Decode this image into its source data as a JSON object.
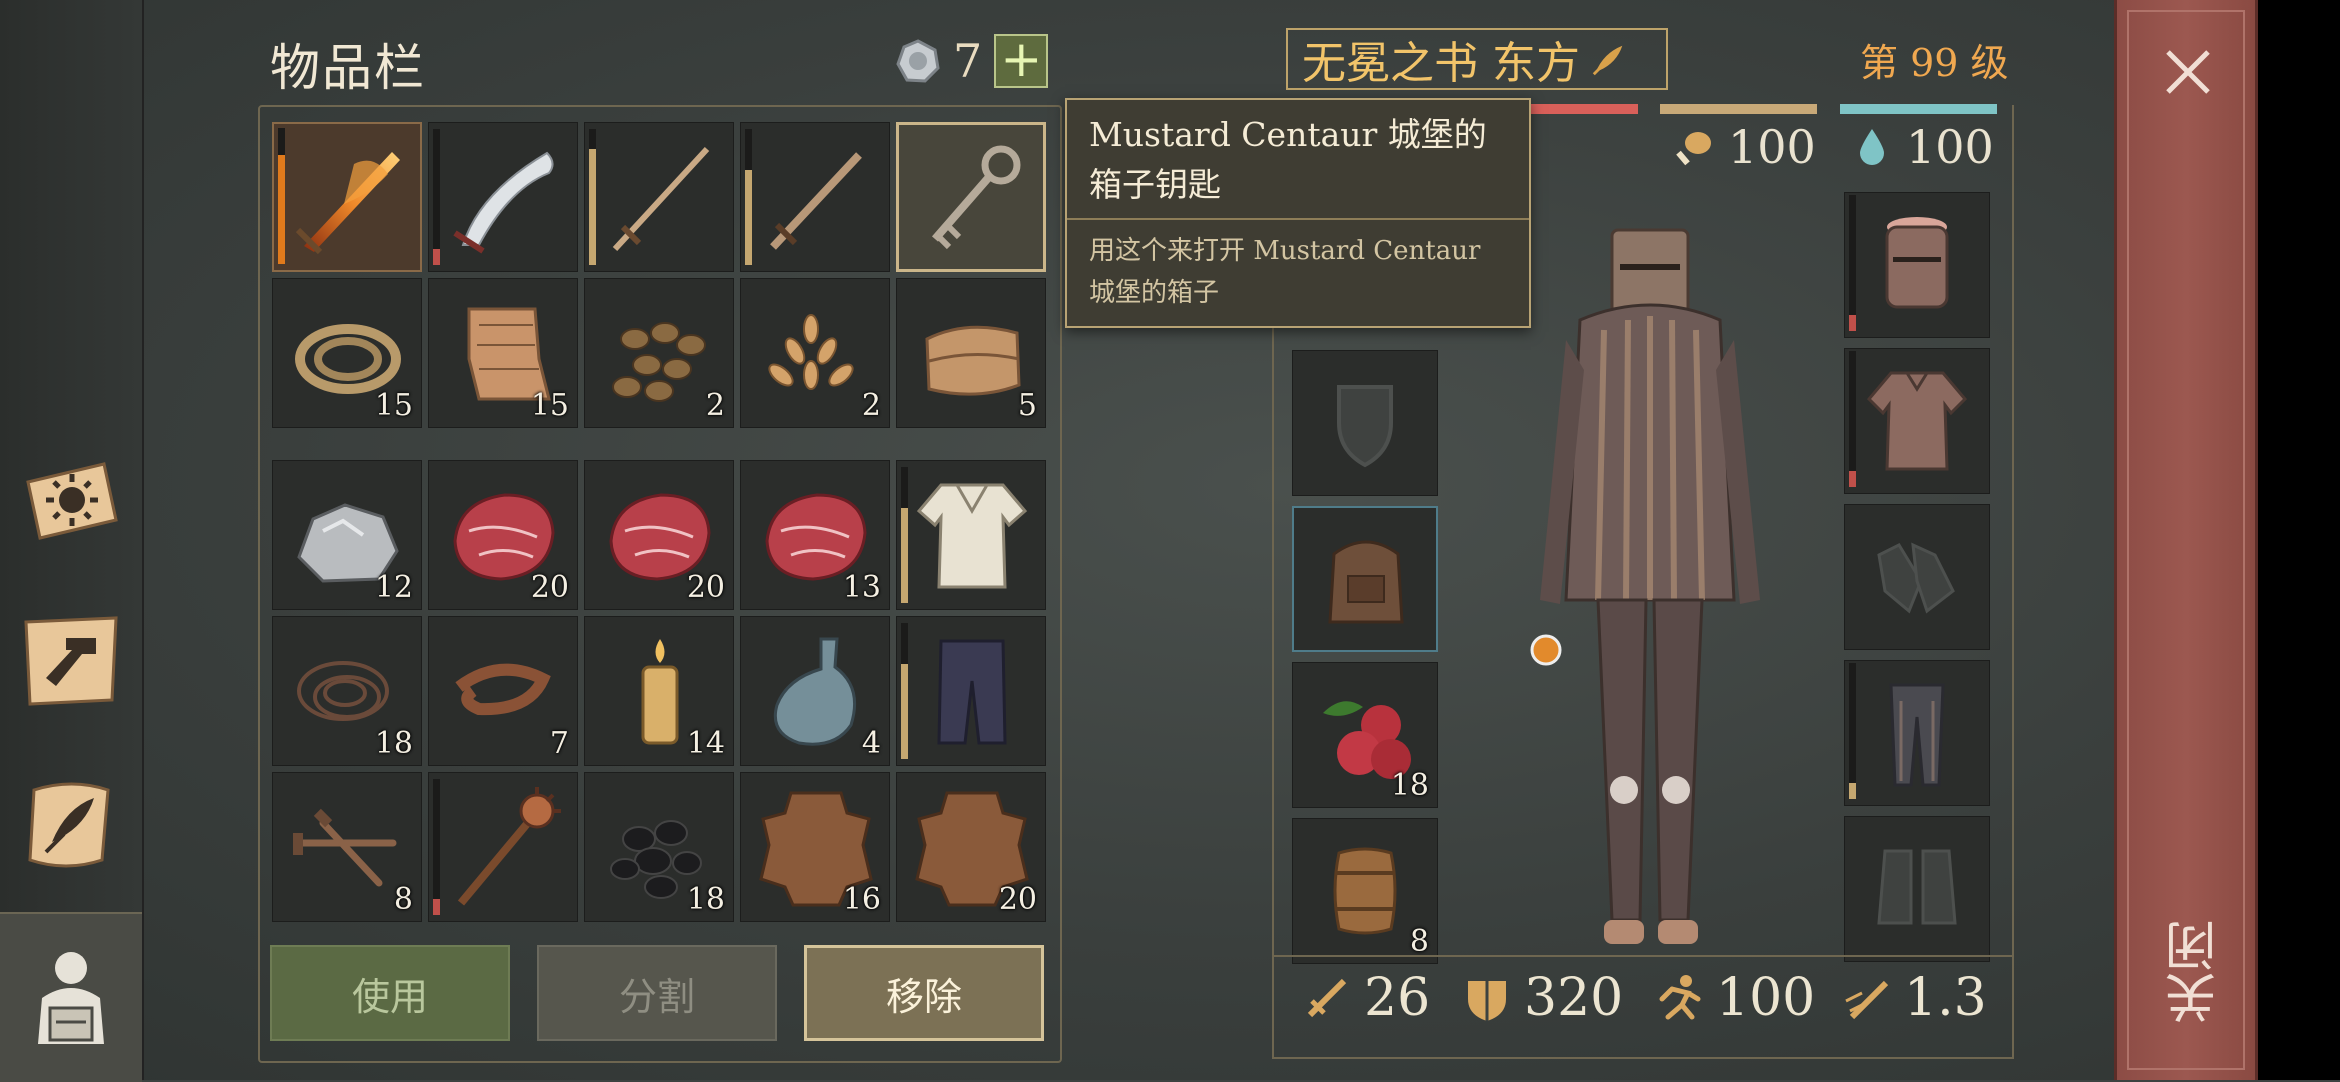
{
  "inventory": {
    "title": "物品栏",
    "currency": {
      "icon": "silver-coin-icon",
      "count": "7",
      "add_label": "+"
    },
    "items": [
      {
        "name": "flaming-sword",
        "qty": "",
        "durability": 0.8,
        "dur_color": "#e07a1c",
        "selected": false,
        "highlight": true
      },
      {
        "name": "scimitar",
        "qty": "",
        "durability": 0.12,
        "dur_color": "#c0504a"
      },
      {
        "name": "longsword",
        "qty": "",
        "durability": 0.85,
        "dur_color": "#c5a770"
      },
      {
        "name": "sword",
        "qty": "",
        "durability": 0.7,
        "dur_color": "#c5a770"
      },
      {
        "name": "key",
        "qty": "",
        "selected": true
      },
      {
        "name": "rope",
        "qty": "15"
      },
      {
        "name": "cloth",
        "qty": "15"
      },
      {
        "name": "beans",
        "qty": "2"
      },
      {
        "name": "seeds",
        "qty": "2"
      },
      {
        "name": "leather-folded",
        "qty": "5"
      },
      {
        "name": "ore-rock",
        "qty": "12"
      },
      {
        "name": "raw-meat",
        "qty": "20"
      },
      {
        "name": "raw-meat",
        "qty": "20"
      },
      {
        "name": "raw-meat",
        "qty": "13"
      },
      {
        "name": "shirt",
        "qty": "",
        "durability": 0.7,
        "dur_color": "#c5a770"
      },
      {
        "name": "string-coil",
        "qty": "18"
      },
      {
        "name": "leather-strap",
        "qty": "7"
      },
      {
        "name": "candle",
        "qty": "14"
      },
      {
        "name": "glass-bottle",
        "qty": "4"
      },
      {
        "name": "trousers",
        "qty": "",
        "durability": 0.7,
        "dur_color": "#c5a770"
      },
      {
        "name": "nails",
        "qty": "8"
      },
      {
        "name": "spiked-mace",
        "qty": "",
        "durability": 0.12,
        "dur_color": "#c0504a"
      },
      {
        "name": "coal",
        "qty": "18"
      },
      {
        "name": "hide",
        "qty": "16"
      },
      {
        "name": "hide",
        "qty": "20"
      }
    ],
    "buttons": {
      "use": "使用",
      "split": "分割",
      "remove": "移除"
    }
  },
  "tooltip": {
    "title": "Mustard Centaur 城堡的箱子钥匙",
    "description": "用这个来打开 Mustard Centaur 城堡的箱子"
  },
  "character": {
    "name": "无冕之书 东方",
    "level": "第 99 级",
    "food": "100",
    "water": "100",
    "bar_colors": {
      "health": "#d9605a",
      "food": "#c8a978",
      "water": "#7fc4c6"
    },
    "left_slots": [
      {
        "name": "shield-slot",
        "qty": ""
      },
      {
        "name": "backpack",
        "qty": ""
      },
      {
        "name": "berries",
        "qty": "18"
      },
      {
        "name": "barrel",
        "qty": "8"
      }
    ],
    "right_slots": [
      {
        "name": "helmet",
        "durability": 0.12
      },
      {
        "name": "chainmail-shirt",
        "durability": 0.12
      },
      {
        "name": "gloves-slot"
      },
      {
        "name": "chain-leggings",
        "durability": 0.12
      },
      {
        "name": "boots-slot"
      }
    ],
    "stats": {
      "attack": "26",
      "armor": "320",
      "speed": "100",
      "attack_speed": "1.3"
    }
  },
  "close": {
    "label": "关闭"
  }
}
